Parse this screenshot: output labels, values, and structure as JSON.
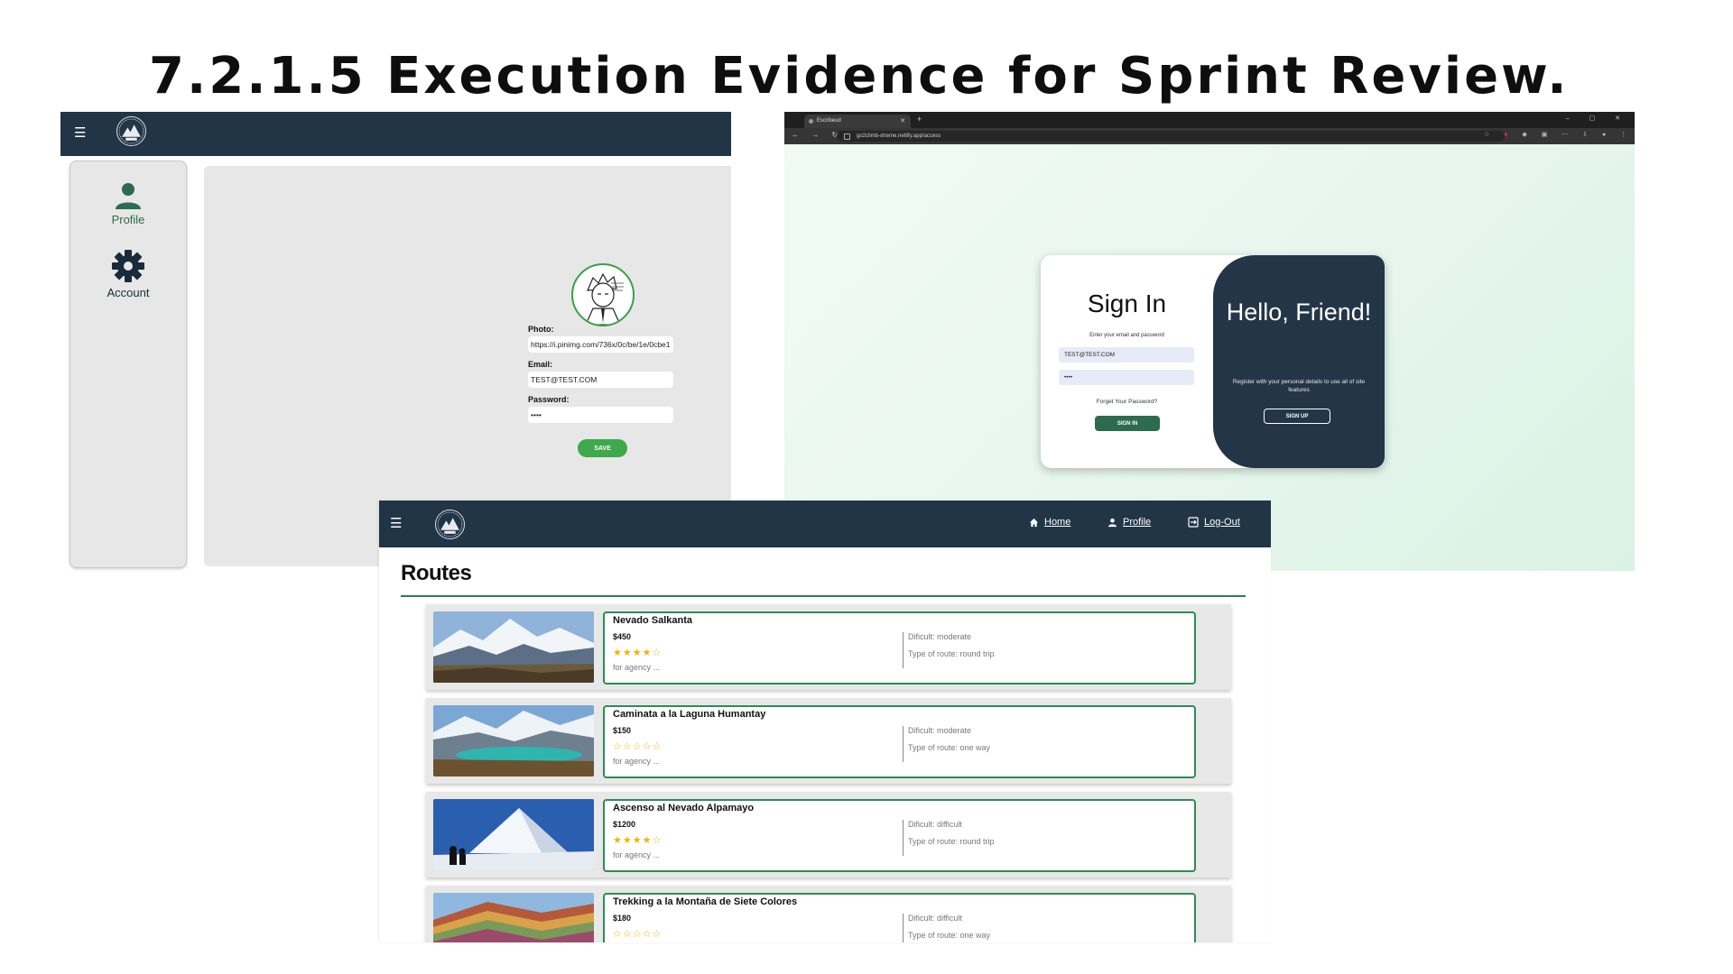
{
  "slide": {
    "title": "7.2.1.5 Execution Evidence for Sprint Review."
  },
  "profile_screen": {
    "sidebar": [
      {
        "label": "Profile",
        "icon": "person-icon",
        "color": "#2c6b4f"
      },
      {
        "label": "Account",
        "icon": "gear-icon",
        "color": "#1b2a3a"
      }
    ],
    "form": {
      "photo_label": "Photo:",
      "photo_value": "https://i.pinimg.com/736x/0c/be/1e/0cbe1e",
      "email_label": "Email:",
      "email_value": "TEST@TEST.COM",
      "password_label": "Password:",
      "password_value": "••••",
      "save_label": "SAVE"
    }
  },
  "signin_screen": {
    "tab_title": "Escribeud",
    "url": "go2climb-xtreme.netlify.app/access",
    "title": "Sign In",
    "subtitle": "Enter your email and password",
    "email_value": "TEST@TEST.COM",
    "password_value": "••••",
    "forgot_label": "Forget Your Password?",
    "signin_label": "SIGN IN",
    "panel_title": "Hello, Friend!",
    "panel_text": "Register with your personal details to use all of site features",
    "signup_label": "SIGN UP"
  },
  "routes_screen": {
    "nav": {
      "home": "Home",
      "profile": "Profile",
      "logout": "Log-Out"
    },
    "title": "Routes",
    "routes": [
      {
        "name": "Nevado Salkanta",
        "price": "$450",
        "stars": "★★★★☆",
        "agency": "for agency ...",
        "difficulty": "Dificult: moderate",
        "type": "Type of route: round trip"
      },
      {
        "name": "Caminata a la Laguna Humantay",
        "price": "$150",
        "stars": "☆☆☆☆☆",
        "agency": "for agency ...",
        "difficulty": "Dificult: moderate",
        "type": "Type of route: one way"
      },
      {
        "name": "Ascenso al Nevado Alpamayo",
        "price": "$1200",
        "stars": "★★★★☆",
        "agency": "for agency ...",
        "difficulty": "Dificult: difficult",
        "type": "Type of route: round trip"
      },
      {
        "name": "Trekking a la Montaña de Siete Colores",
        "price": "$180",
        "stars": "☆☆☆☆☆",
        "agency": "",
        "difficulty": "Dificult: difficult",
        "type": "Type of route: one way"
      }
    ]
  },
  "colors": {
    "navbar": "#213547",
    "accent_green": "#2e8b57",
    "save_green": "#3ea84c",
    "star": "#f0b400"
  }
}
